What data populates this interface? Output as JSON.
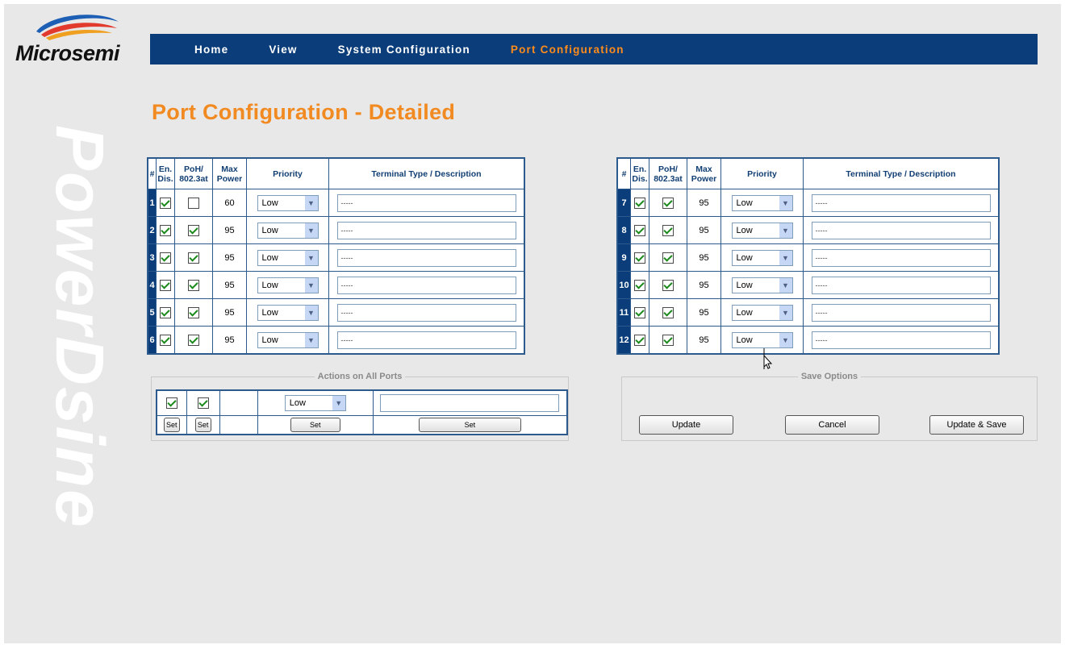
{
  "brand": {
    "name": "Microsemi",
    "watermark": "PowerDsine"
  },
  "nav": {
    "items": [
      "Home",
      "View",
      "System Configuration",
      "Port Configuration"
    ],
    "active": "Port Configuration"
  },
  "page_title": "Port Configuration - Detailed",
  "table_headers": {
    "num": "#",
    "en_line1": "En.",
    "en_line2": "Dis.",
    "poh_line1": "PoH/",
    "poh_line2": "802.3at",
    "max_line1": "Max",
    "max_line2": "Power",
    "priority": "Priority",
    "terminal": "Terminal Type / Description"
  },
  "ports": [
    {
      "num": "1",
      "enabled": true,
      "poh": false,
      "max_power": "60",
      "priority": "Low",
      "description": "-----"
    },
    {
      "num": "2",
      "enabled": true,
      "poh": true,
      "max_power": "95",
      "priority": "Low",
      "description": "-----"
    },
    {
      "num": "3",
      "enabled": true,
      "poh": true,
      "max_power": "95",
      "priority": "Low",
      "description": "-----"
    },
    {
      "num": "4",
      "enabled": true,
      "poh": true,
      "max_power": "95",
      "priority": "Low",
      "description": "-----"
    },
    {
      "num": "5",
      "enabled": true,
      "poh": true,
      "max_power": "95",
      "priority": "Low",
      "description": "-----"
    },
    {
      "num": "6",
      "enabled": true,
      "poh": true,
      "max_power": "95",
      "priority": "Low",
      "description": "-----"
    },
    {
      "num": "7",
      "enabled": true,
      "poh": true,
      "max_power": "95",
      "priority": "Low",
      "description": "-----"
    },
    {
      "num": "8",
      "enabled": true,
      "poh": true,
      "max_power": "95",
      "priority": "Low",
      "description": "-----"
    },
    {
      "num": "9",
      "enabled": true,
      "poh": true,
      "max_power": "95",
      "priority": "Low",
      "description": "-----"
    },
    {
      "num": "10",
      "enabled": true,
      "poh": true,
      "max_power": "95",
      "priority": "Low",
      "description": "-----"
    },
    {
      "num": "11",
      "enabled": true,
      "poh": true,
      "max_power": "95",
      "priority": "Low",
      "description": "-----"
    },
    {
      "num": "12",
      "enabled": true,
      "poh": true,
      "max_power": "95",
      "priority": "Low",
      "description": "-----"
    }
  ],
  "actions": {
    "legend": "Actions on All Ports",
    "enabled": true,
    "poh": true,
    "priority": "Low",
    "description": "",
    "set_label": "Set"
  },
  "save_options": {
    "legend": "Save Options",
    "update_label": "Update",
    "cancel_label": "Cancel",
    "update_save_label": "Update & Save"
  }
}
